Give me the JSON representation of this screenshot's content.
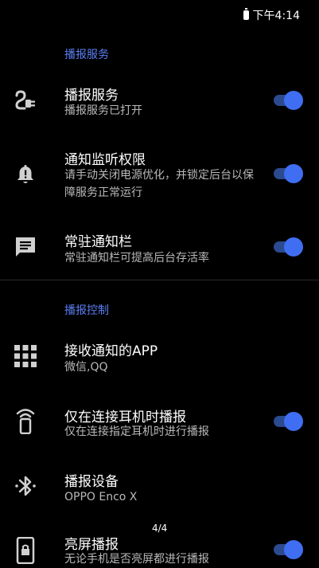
{
  "status_bar": {
    "time": "下午4:14"
  },
  "sections": [
    {
      "header": "播报服务"
    },
    {
      "header": "播报控制"
    }
  ],
  "items": [
    {
      "title": "播报服务",
      "subtitle": "播报服务已打开",
      "icon": "power-plug-icon",
      "toggle": true
    },
    {
      "title": "通知监听权限",
      "subtitle": "请手动关闭电源优化，并锁定后台以保障服务正常运行",
      "icon": "bell-alert-icon",
      "toggle": true
    },
    {
      "title": "常驻通知栏",
      "subtitle": "常驻通知栏可提高后台存活率",
      "icon": "message-icon",
      "toggle": true
    },
    {
      "title": "接收通知的APP",
      "subtitle": "微信,QQ",
      "icon": "apps-grid-icon",
      "toggle": null
    },
    {
      "title": "仅在连接耳机时播报",
      "subtitle": "仅在连接指定耳机时进行播报",
      "icon": "device-signal-icon",
      "toggle": true
    },
    {
      "title": "播报设备",
      "subtitle": "OPPO Enco X",
      "icon": "bluetooth-icon",
      "toggle": null
    },
    {
      "title": "亮屏播报",
      "subtitle": "无论手机是否亮屏都进行播报",
      "icon": "screen-lock-icon",
      "toggle": true
    }
  ],
  "page_indicator": "4/4",
  "colors": {
    "accent": "#3f6ef2",
    "accent_track": "#2b4a8f",
    "header": "#5b7ff5",
    "background": "#000000"
  }
}
